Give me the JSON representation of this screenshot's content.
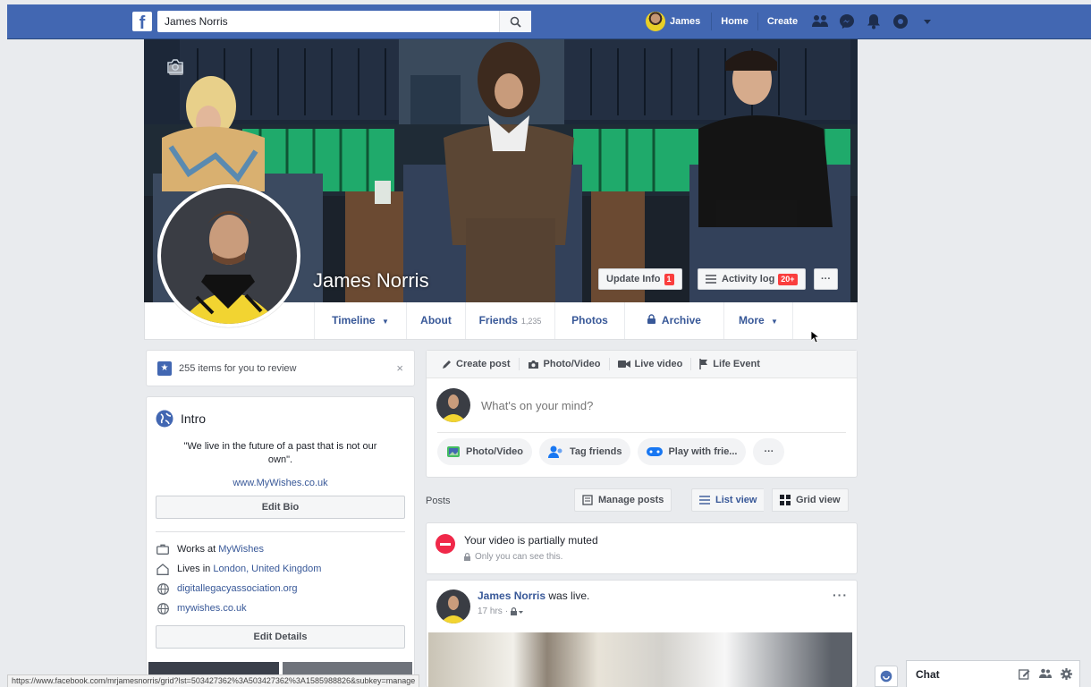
{
  "topbar": {
    "logo": "f",
    "search_value": "James Norris",
    "user_name": "James",
    "home_label": "Home",
    "create_label": "Create",
    "icons": [
      "friend-requests-icon",
      "messenger-icon",
      "notifications-icon",
      "quick-help-icon",
      "account-menu-icon"
    ]
  },
  "profile": {
    "name": "James Norris",
    "update_info_label": "Update Info",
    "update_info_badge": "1",
    "activity_log_label": "Activity log",
    "activity_log_badge": "20+",
    "more_dots": "···"
  },
  "tabs": {
    "timeline": "Timeline",
    "about": "About",
    "friends": "Friends",
    "friends_count": "1,235",
    "photos": "Photos",
    "archive": "Archive",
    "more": "More"
  },
  "review": {
    "text": "255 items for you to review",
    "close": "×"
  },
  "intro": {
    "title": "Intro",
    "quote": "\"We live in the future of a past that is not our own\".",
    "website": "www.MyWishes.co.uk",
    "edit_bio": "Edit Bio",
    "works_prefix": "Works at ",
    "works_link": "MyWishes",
    "lives_prefix": "Lives in ",
    "lives_link": "London, United Kingdom",
    "link1": "digitallegacyassociation.org",
    "link2": "mywishes.co.uk",
    "edit_details": "Edit Details"
  },
  "composer": {
    "create_post": "Create post",
    "photo_video_tab": "Photo/Video",
    "live_video": "Live video",
    "life_event": "Life Event",
    "placeholder": "What's on your mind?",
    "photo_video": "Photo/Video",
    "tag_friends": "Tag friends",
    "play_with": "Play with frie...",
    "more": "···"
  },
  "posts": {
    "label": "Posts",
    "manage": "Manage posts",
    "list_view": "List view",
    "grid_view": "Grid view"
  },
  "muted": {
    "title": "Your video is partially muted",
    "sub": "Only you can see this."
  },
  "post": {
    "author": "James Norris",
    "action": " was live.",
    "time": "17 hrs",
    "more": "···"
  },
  "statusbar": {
    "url": "https://www.facebook.com/mrjamesnorris/grid?lst=503427362%3A503427362%3A1585988826&subkey=manage"
  },
  "chat": {
    "label": "Chat"
  },
  "colors": {
    "brand": "#4267b2",
    "link": "#385898",
    "badge": "#fa3e3e"
  }
}
